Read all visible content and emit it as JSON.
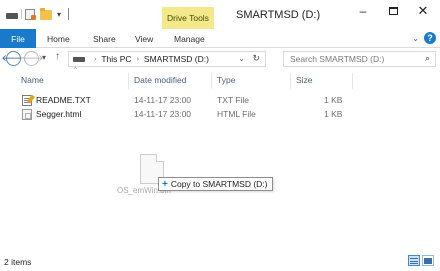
{
  "titlebar": {
    "context_tab": "Drive Tools",
    "title": "SMARTMSD (D:)",
    "minimize": "–",
    "close": "✕"
  },
  "ribbon": {
    "tabs": [
      "File",
      "Home",
      "Share",
      "View",
      "Manage"
    ],
    "collapse_icon": "⌄",
    "help_icon": "?"
  },
  "navigation": {
    "back_icon": "🡐",
    "forward_icon": "🡒",
    "recent_icon": "▾",
    "up_icon": "↑",
    "breadcrumb": [
      "This PC",
      "SMARTMSD (D:)"
    ],
    "breadcrumb_separator": "›",
    "address_dropdown": "⌄",
    "refresh_icon": "↻",
    "search_placeholder": "Search SMARTMSD (D:)",
    "search_icon": "⌕"
  },
  "file_list": {
    "columns": [
      "Name",
      "Date modified",
      "Type",
      "Size"
    ],
    "sort_caret": "^",
    "rows": [
      {
        "name": "README.TXT",
        "date": "14-11-17 23:00",
        "type": "TXT File",
        "size": "1 KB",
        "icon": "text-file-icon"
      },
      {
        "name": "Segger.html",
        "date": "14-11-17 23:00",
        "type": "HTML File",
        "size": "1 KB",
        "icon": "html-file-icon"
      }
    ]
  },
  "drag": {
    "ghost_label": "OS_emWin.bin",
    "tooltip_plus": "+",
    "tooltip": "Copy to SMARTMSD (D:)"
  },
  "status": {
    "item_count": "2 items"
  },
  "colors": {
    "file_tab": "#1979ca",
    "drive_tools": "#f3e98b",
    "column_header": "#4c607a"
  }
}
